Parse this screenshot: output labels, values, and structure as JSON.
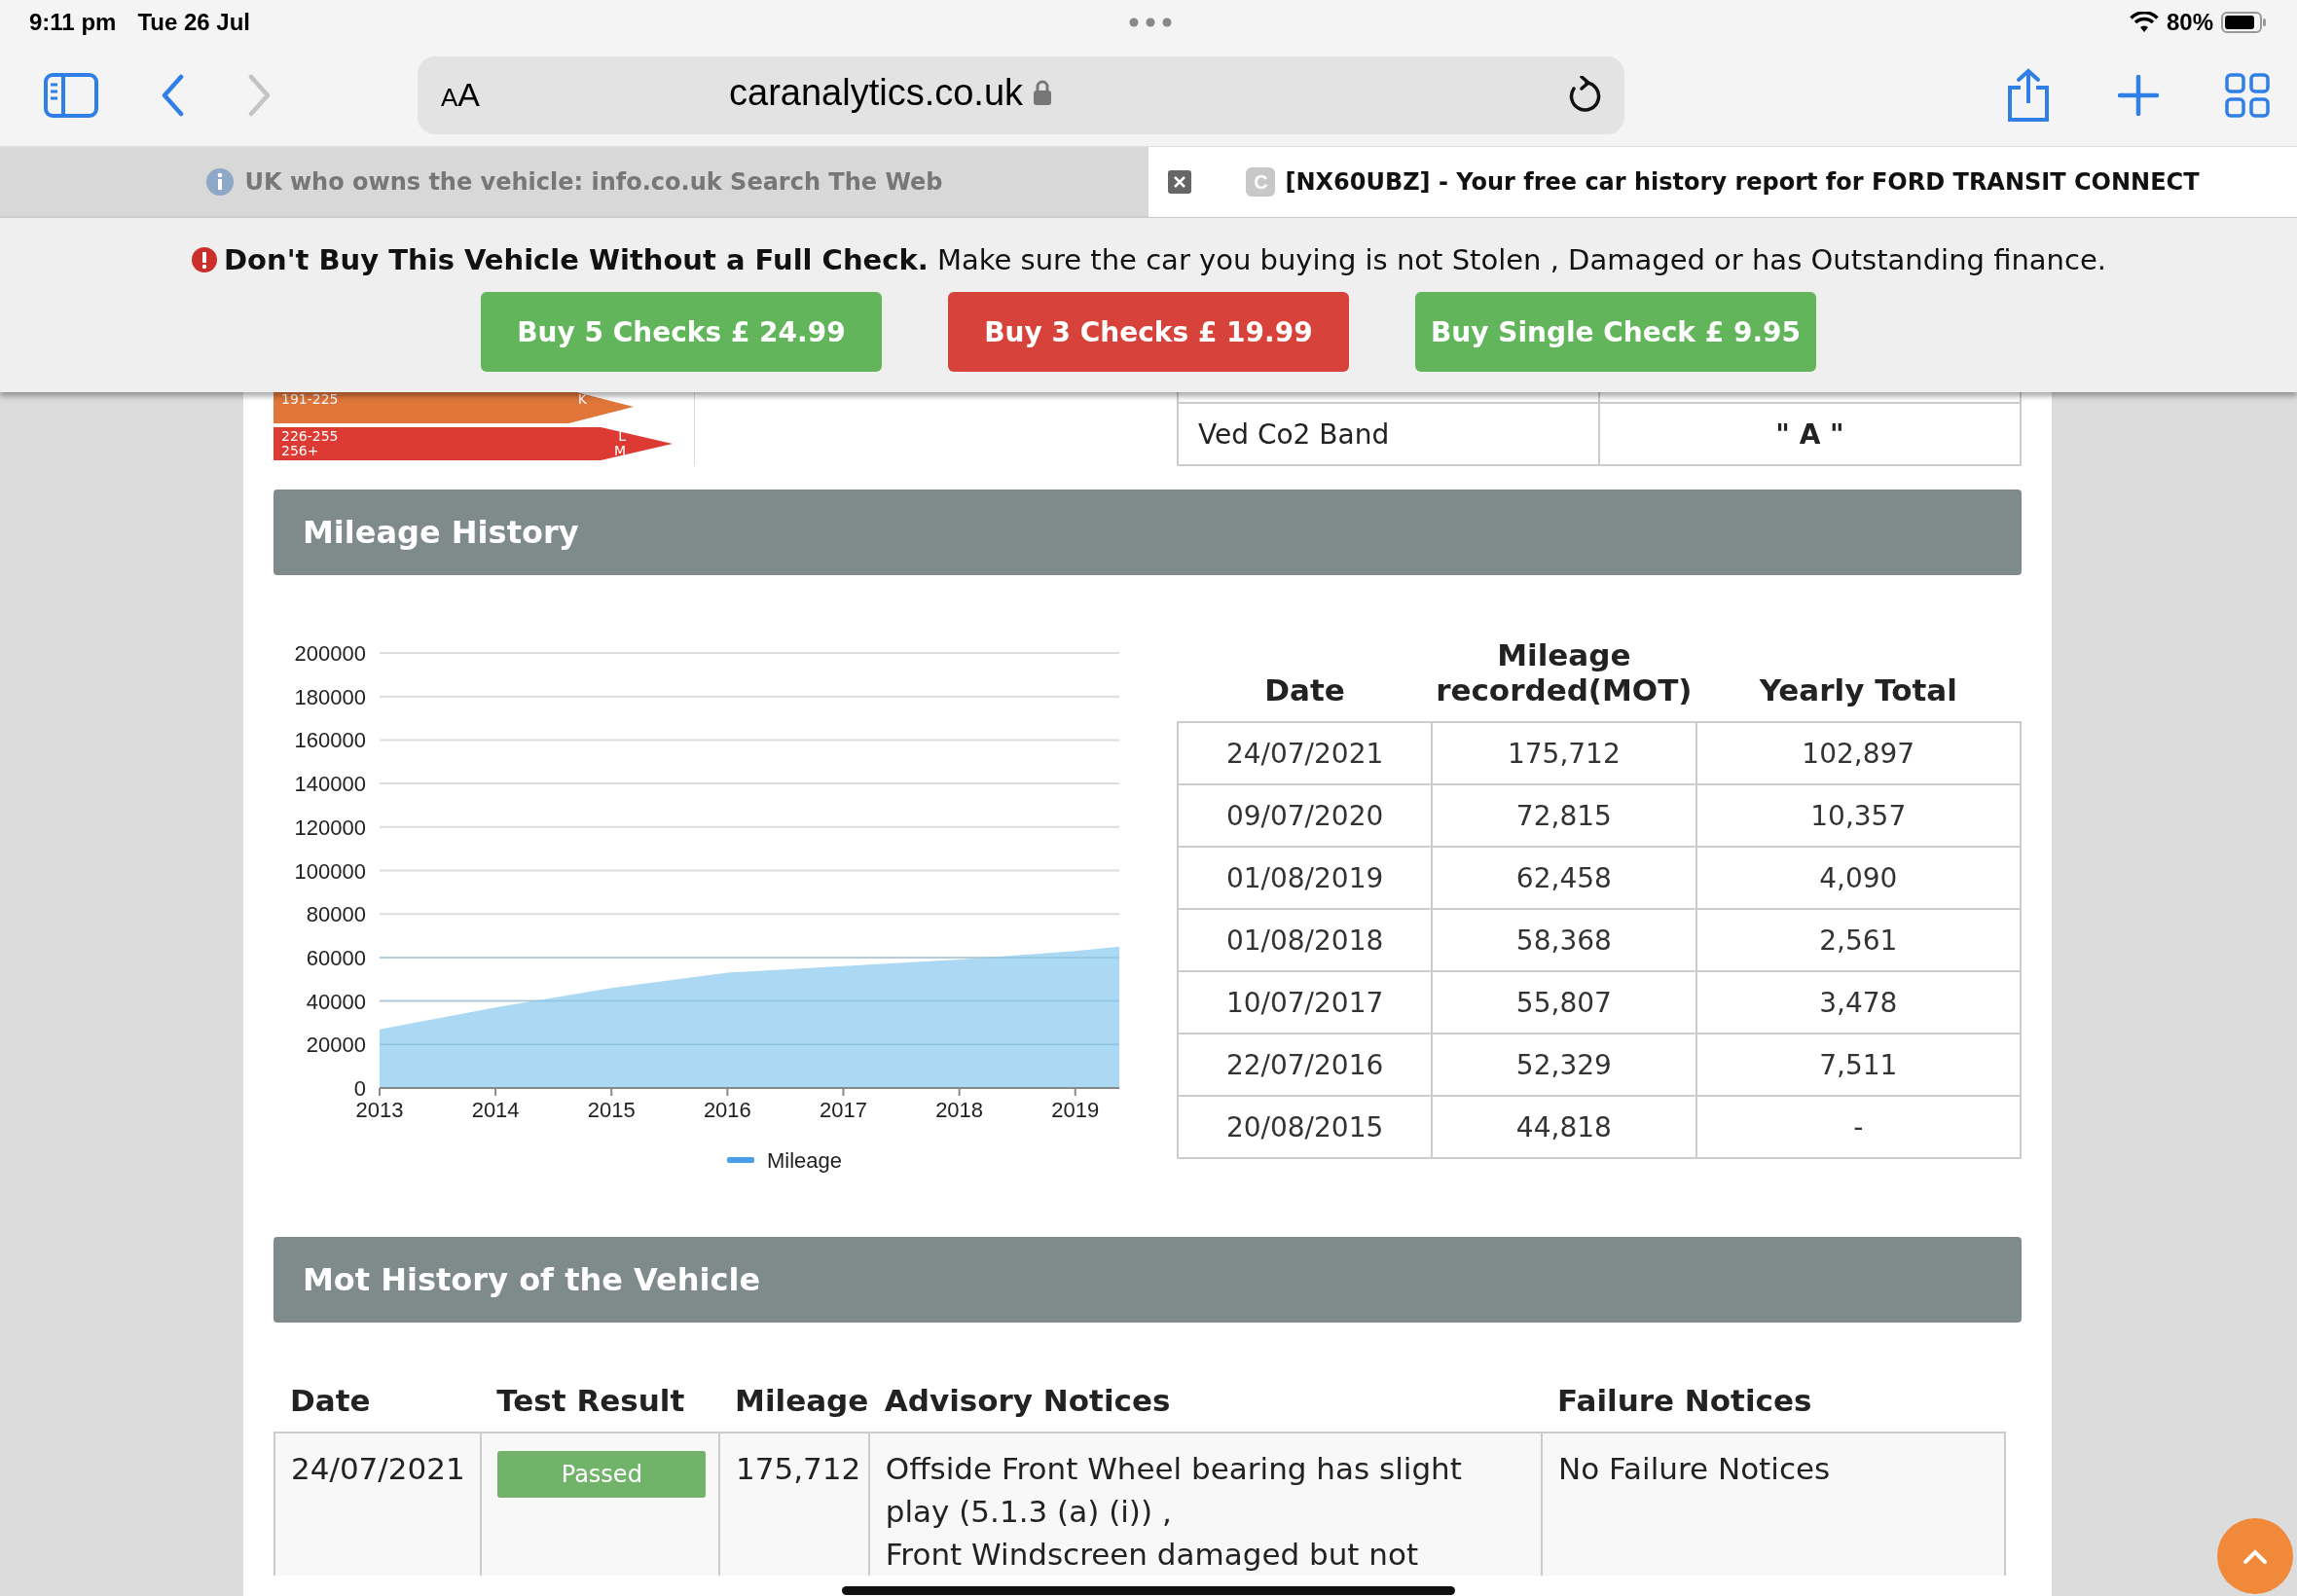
{
  "status_bar": {
    "time": "9:11 pm",
    "date": "Tue 26 Jul",
    "battery": "80%"
  },
  "address_bar": {
    "text_size_button": "AA",
    "url": "caranalytics.co.uk"
  },
  "tabs": [
    {
      "title": "UK who owns the vehicle: info.co.uk Search The Web",
      "selected": false
    },
    {
      "title": "[NX60UBZ] - Your free car history report for FORD TRANSIT CONNECT",
      "favicon": "C",
      "selected": true
    }
  ],
  "banner": {
    "message": "**Don't Buy This Vehicle Without a Full Check.** Make sure the car you buying is not Stolen , Damaged or has Outstanding finance.",
    "buttons": [
      {
        "label": "Buy 5 Checks £ 24.99",
        "color": "#62b55a"
      },
      {
        "label": "Buy 3 Checks £ 19.99",
        "color": "#d7433a"
      },
      {
        "label": "Buy Single Check £ 9.95",
        "color": "#62b55a"
      }
    ]
  },
  "co2_bands": [
    {
      "ranges": [
        "191-225"
      ],
      "letters": [
        "K"
      ],
      "color": "#e0763a"
    },
    {
      "ranges": [
        "226-255",
        "256+"
      ],
      "letters": [
        "L",
        "M"
      ],
      "color": "#dc3a32"
    }
  ],
  "ved_table": {
    "rows": [
      {
        "label": "Ved Co2 Band",
        "value": "\" A \""
      }
    ]
  },
  "mileage_history": {
    "title": "Mileage History",
    "chart_data": {
      "type": "area",
      "x": [
        2013,
        2014,
        2015,
        2016,
        2017,
        2018,
        2019,
        2019.38
      ],
      "series": [
        {
          "name": "Mileage",
          "color": "#a6d6f2",
          "values": [
            27000,
            37000,
            46000,
            53000,
            56000,
            59000,
            63000,
            65000
          ]
        }
      ],
      "grid": true,
      "xlim": [
        2013,
        2019.38
      ],
      "ylim": [
        0,
        200000
      ],
      "xticks": [
        2013,
        2014,
        2015,
        2016,
        2017,
        2018,
        2019
      ],
      "yticks": [
        0,
        20000,
        40000,
        60000,
        80000,
        100000,
        120000,
        140000,
        160000,
        180000,
        200000
      ]
    },
    "table": {
      "columns": [
        "Date",
        "Mileage recorded(MOT)",
        "Yearly Total"
      ],
      "rows": [
        [
          "24/07/2021",
          "175,712",
          "102,897"
        ],
        [
          "09/07/2020",
          "72,815",
          "10,357"
        ],
        [
          "01/08/2019",
          "62,458",
          "4,090"
        ],
        [
          "01/08/2018",
          "58,368",
          "2,561"
        ],
        [
          "10/07/2017",
          "55,807",
          "3,478"
        ],
        [
          "22/07/2016",
          "52,329",
          "7,511"
        ],
        [
          "20/08/2015",
          "44,818",
          "-"
        ]
      ]
    }
  },
  "mot_history": {
    "title": "Mot History of the Vehicle",
    "columns": [
      "Date",
      "Test Result",
      "Mileage",
      "Advisory Notices",
      "Failure Notices"
    ],
    "rows": [
      {
        "date": "24/07/2021",
        "result": "Passed",
        "kind": "pass",
        "mileage": "175,712",
        "advisories": [
          "Offside Front Wheel bearing has slight play (5.1.3 (a) (i)) ,",
          "Front Windscreen damaged but not"
        ],
        "failures": "No Failure Notices"
      }
    ]
  }
}
